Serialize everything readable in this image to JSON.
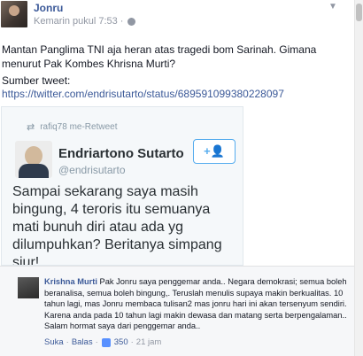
{
  "post": {
    "author": "Jonru",
    "timestamp": "Kemarin pukul 7:53",
    "separator": "·",
    "status": "Mantan Panglima TNI aja heran atas tragedi bom Sarinah. Gimana menurut Pak Kombes Khrisna Murti?",
    "source_label": "Sumber tweet:",
    "source_url": "https://twitter.com/endrisutarto/status/689591099380228097",
    "menu_icon": "chevron-down-icon",
    "privacy_icon": "globe-icon"
  },
  "tweet": {
    "retweet_by": "rafiq78 me-Retweet",
    "retweet_icon": "retweet-icon",
    "name": "Endriartono Sutarto",
    "handle": "@endrisutarto",
    "follow_label": "+👤",
    "text": "Sampai sekarang saya masih bingung, 4 teroris itu semuanya mati bunuh diri atau ada yg dilumpuhkan? Beritanya simpang siur!"
  },
  "comment": {
    "author": "Krishna Murti",
    "text": "Pak Jonru saya penggemar anda.. Negara demokrasi; semua boleh beranalisa, semua boleh bingung,. Teruslah menulis supaya makin berkualitas. 10 tahun lagi, mas Jonru membaca tulisan2 mas jonru hari ini akan tersenyum sendiri. Karena anda pada 10 tahun lagi makin dewasa dan matang serta berpengalaman.. Salam hormat saya dari penggemar anda..",
    "like_label": "Suka",
    "reply_label": "Balas",
    "like_count": "350",
    "time": "21 jam",
    "separator": "·",
    "like_icon": "thumbs-up-icon"
  }
}
